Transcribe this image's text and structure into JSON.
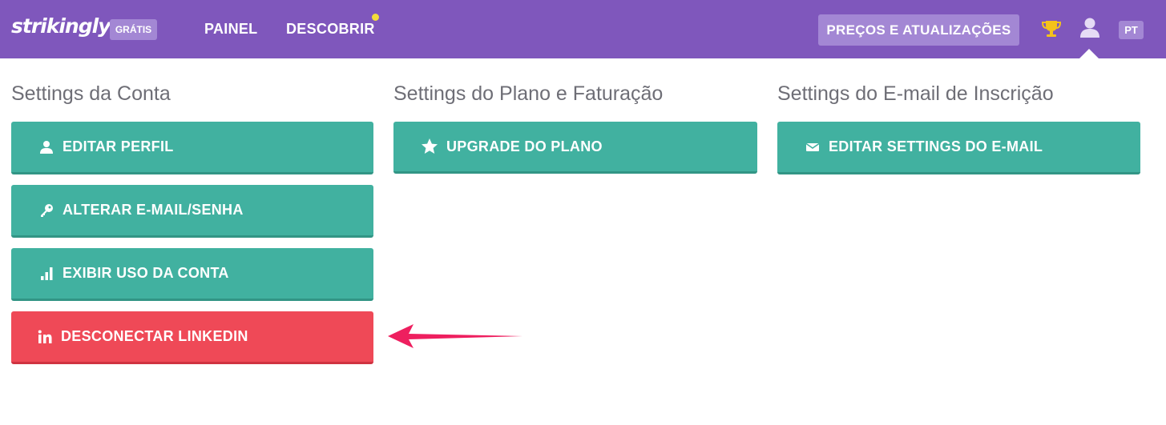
{
  "header": {
    "logo": "strikingly",
    "plan_badge": "GRÁTIS",
    "nav": {
      "painel": "PAINEL",
      "descobrir": "DESCOBRIR"
    },
    "pricing_button": "PREÇOS E ATUALIZAÇÕES",
    "language": "PT",
    "icons": [
      "trophy-icon",
      "user-icon"
    ]
  },
  "sections": {
    "account": {
      "title": "Settings da Conta",
      "buttons": [
        {
          "label": "EDITAR PERFIL",
          "icon": "user-icon"
        },
        {
          "label": "ALTERAR E-MAIL/SENHA",
          "icon": "key-icon"
        },
        {
          "label": "EXIBIR USO DA CONTA",
          "icon": "bar-chart-icon"
        },
        {
          "label": "DESCONECTAR LINKEDIN",
          "icon": "linkedin-icon"
        }
      ]
    },
    "plan": {
      "title": "Settings do Plano e Faturação",
      "buttons": [
        {
          "label": "UPGRADE DO PLANO",
          "icon": "star-icon"
        }
      ]
    },
    "email": {
      "title": "Settings do E-mail de Inscrição",
      "buttons": [
        {
          "label": "EDITAR SETTINGS DO E-MAIL",
          "icon": "envelope-icon"
        }
      ]
    }
  },
  "colors": {
    "header_bg": "#7f57bc",
    "badge_bg": "#a387d4",
    "teal_button": "#41b1a0",
    "red_button": "#ef4957",
    "notification_dot": "#f4dc3a",
    "trophy": "#f4c21b",
    "arrow": "#ee1f5f"
  }
}
